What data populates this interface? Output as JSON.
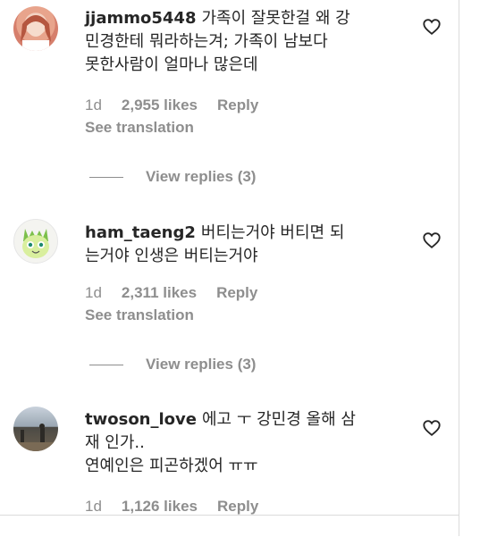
{
  "comments": [
    {
      "username": "jjammo5448",
      "text_line1": "가족이 잘못한걸 왜 강",
      "text_line2": "민경한테 뭐라하는겨; 가족이 남보다",
      "text_line3": "못한사람이 얼마나 많은데",
      "time": "1d",
      "likes": "2,955 likes",
      "reply": "Reply",
      "translation": "See translation",
      "view_replies": "View replies (3)"
    },
    {
      "username": "ham_taeng2",
      "text_line1": "버티는거야 버티면 되",
      "text_line2": "는거야 인생은 버티는거야",
      "time": "1d",
      "likes": "2,311 likes",
      "reply": "Reply",
      "translation": "See translation",
      "view_replies": "View replies (3)"
    },
    {
      "username": "twoson_love",
      "text_line1": "에고 ㅜ 강민경 올해 삼",
      "text_line2": "재 인가..",
      "text_line3": "연예인은 피곤하겠어 ㅠㅠ",
      "time": "1d",
      "likes": "1,126 likes",
      "reply": "Reply"
    }
  ],
  "icons": {
    "like": "heart-outline-icon"
  }
}
